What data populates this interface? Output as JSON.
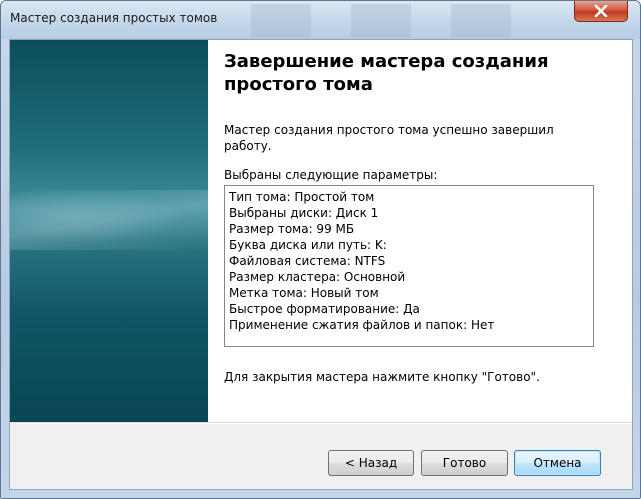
{
  "window": {
    "title": "Мастер создания простых томов"
  },
  "page": {
    "heading": "Завершение мастера создания простого тома",
    "description": "Мастер создания простого тома успешно завершил работу.",
    "params_label": "Выбраны следующие параметры:",
    "params": [
      "Тип тома: Простой том",
      "Выбраны диски: Диск 1",
      "Размер тома: 99 МБ",
      "Буква диска или путь: K:",
      "Файловая система: NTFS",
      "Размер кластера: Основной",
      "Метка тома: Новый том",
      "Быстрое форматирование: Да",
      "Применение сжатия файлов и папок: Нет"
    ],
    "finish_hint": "Для закрытия мастера нажмите кнопку \"Готово\"."
  },
  "buttons": {
    "back": "< Назад",
    "finish": "Готово",
    "cancel": "Отмена"
  },
  "icons": {
    "close": "close-icon"
  },
  "colors": {
    "side_panel": "#1e6d7c",
    "close_button": "#c03a20",
    "default_button_border": "#3c7fb1"
  }
}
